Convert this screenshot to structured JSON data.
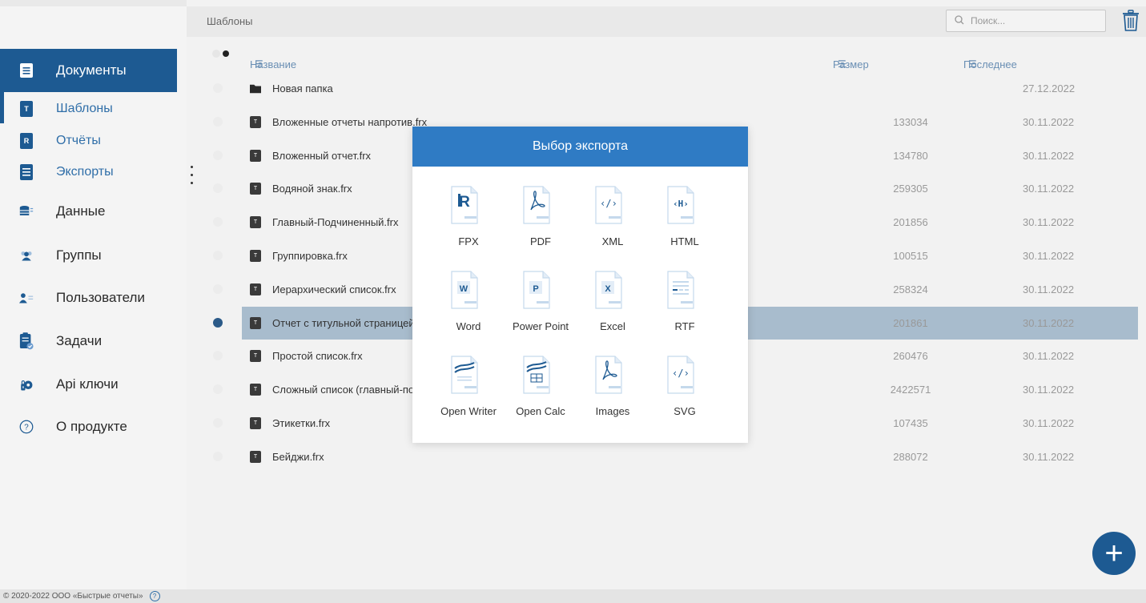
{
  "breadcrumb": "Шаблоны",
  "search": {
    "placeholder": "Поиск..."
  },
  "sidebar": {
    "items": [
      {
        "label": "Документы",
        "icon": "document-icon"
      },
      {
        "label": "Шаблоны",
        "icon": "template-icon",
        "badge": "T"
      },
      {
        "label": "Отчёты",
        "icon": "report-icon",
        "badge": "R"
      },
      {
        "label": "Экспорты",
        "icon": "export-icon"
      },
      {
        "label": "Данные",
        "icon": "database-icon"
      },
      {
        "label": "Группы",
        "icon": "groups-icon"
      },
      {
        "label": "Пользователи",
        "icon": "users-icon"
      },
      {
        "label": "Задачи",
        "icon": "tasks-icon"
      },
      {
        "label": "Api ключи",
        "icon": "api-keys-icon"
      },
      {
        "label": "О продукте",
        "icon": "help-icon"
      }
    ]
  },
  "table": {
    "headers": {
      "name": "Название",
      "size": "Размер",
      "modified": "Последнее изменение"
    },
    "rows": [
      {
        "name": "Новая папка",
        "size": "",
        "date": "27.12.2022",
        "type": "folder"
      },
      {
        "name": "Вложенные отчеты напротив.frx",
        "size": "133034",
        "date": "30.11.2022",
        "type": "template"
      },
      {
        "name": "Вложенный отчет.frx",
        "size": "134780",
        "date": "30.11.2022",
        "type": "template"
      },
      {
        "name": "Водяной знак.frx",
        "size": "259305",
        "date": "30.11.2022",
        "type": "template"
      },
      {
        "name": "Главный-Подчиненный.frx",
        "size": "201856",
        "date": "30.11.2022",
        "type": "template"
      },
      {
        "name": "Группировка.frx",
        "size": "100515",
        "date": "30.11.2022",
        "type": "template"
      },
      {
        "name": "Иерархический список.frx",
        "size": "258324",
        "date": "30.11.2022",
        "type": "template"
      },
      {
        "name": "Отчет с титульной страницей.frx",
        "size": "201861",
        "date": "30.11.2022",
        "type": "template",
        "selected": true
      },
      {
        "name": "Простой список.frx",
        "size": "260476",
        "date": "30.11.2022",
        "type": "template"
      },
      {
        "name": "Сложный список (главный-подчиненный).frx",
        "size": "2422571",
        "date": "30.11.2022",
        "type": "template"
      },
      {
        "name": "Этикетки.frx",
        "size": "107435",
        "date": "30.11.2022",
        "type": "template"
      },
      {
        "name": "Бейджи.frx",
        "size": "288072",
        "date": "30.11.2022",
        "type": "template"
      }
    ]
  },
  "dialog": {
    "title": "Выбор экспорта",
    "formats": [
      {
        "label": "FPX",
        "icon": "fpx-icon"
      },
      {
        "label": "PDF",
        "icon": "pdf-icon"
      },
      {
        "label": "XML",
        "icon": "xml-icon"
      },
      {
        "label": "HTML",
        "icon": "html-icon"
      },
      {
        "label": "Word",
        "icon": "word-icon"
      },
      {
        "label": "Power Point",
        "icon": "powerpoint-icon"
      },
      {
        "label": "Excel",
        "icon": "excel-icon"
      },
      {
        "label": "RTF",
        "icon": "rtf-icon"
      },
      {
        "label": "Open Writer",
        "icon": "open-writer-icon"
      },
      {
        "label": "Open Calc",
        "icon": "open-calc-icon"
      },
      {
        "label": "Images",
        "icon": "images-icon"
      },
      {
        "label": "SVG",
        "icon": "svg-icon"
      }
    ]
  },
  "footer": {
    "copyright": "© 2020-2022 ООО «Быстрые отчеты»",
    "help": "?"
  },
  "fab_label": "+",
  "colors": {
    "primary": "#1d5a92",
    "dialog_header": "#2f7bc4",
    "selected_row": "#a8bccd"
  }
}
